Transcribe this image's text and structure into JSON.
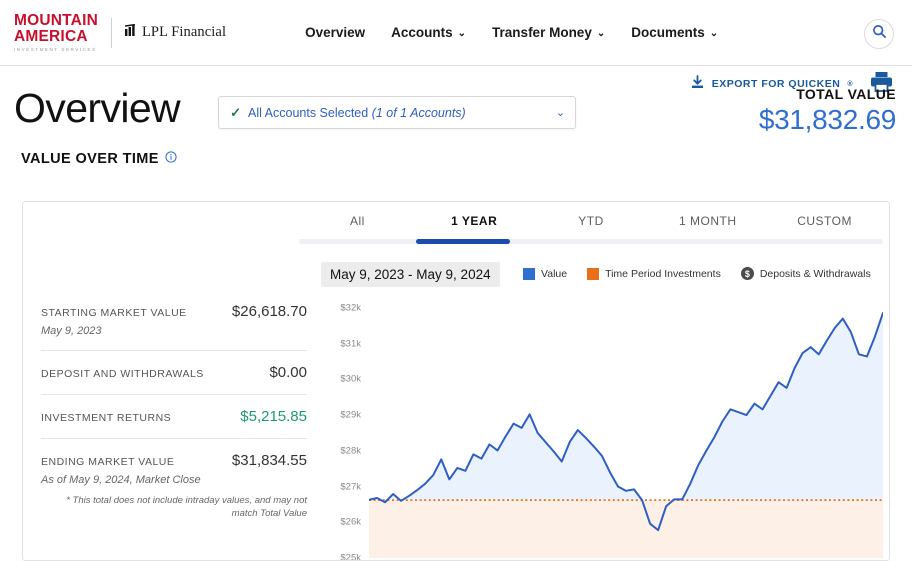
{
  "header": {
    "brand": {
      "mountain_line1": "MOUNTAIN",
      "mountain_line2": "AMERICA",
      "tagline": "INVESTMENT SERVICES",
      "partner": "LPL Financial"
    },
    "nav": [
      {
        "label": "Overview",
        "has_caret": false
      },
      {
        "label": "Accounts",
        "has_caret": true
      },
      {
        "label": "Transfer Money",
        "has_caret": true
      },
      {
        "label": "Documents",
        "has_caret": true
      }
    ],
    "search_icon": "search-icon"
  },
  "actions": {
    "export_label": "EXPORT FOR QUICKEN",
    "export_sup": "®",
    "download_icon": "download-icon",
    "print_icon": "printer-icon"
  },
  "page": {
    "title": "Overview",
    "account_selector": {
      "check": "✓",
      "text": "All Accounts Selected",
      "count": "(1 of 1 Accounts)",
      "caret": "⌄"
    },
    "total_label": "TOTAL VALUE",
    "total_value": "$31,832.69"
  },
  "section": {
    "title": "VALUE OVER TIME",
    "info_icon": "info-icon"
  },
  "tabs": [
    {
      "label": "All",
      "active": false
    },
    {
      "label": "1 YEAR",
      "active": true
    },
    {
      "label": "YTD",
      "active": false
    },
    {
      "label": "1 MONTH",
      "active": false
    },
    {
      "label": "CUSTOM",
      "active": false
    }
  ],
  "chart_header": {
    "date_range": "May 9, 2023 - May 9, 2024",
    "legend": [
      {
        "label": "Value",
        "type": "square",
        "color": "#2f6fd0"
      },
      {
        "label": "Time Period Investments",
        "type": "square",
        "color": "#e8701a"
      },
      {
        "label": "Deposits & Withdrawals",
        "type": "coin",
        "color": "#4b4b4b",
        "glyph": "$"
      }
    ]
  },
  "stats": [
    {
      "label": "STARTING MARKET VALUE",
      "value": "$26,618.70",
      "sub": "May 9, 2023",
      "value_color": "#333333"
    },
    {
      "label": "DEPOSIT AND WITHDRAWALS",
      "value": "$0.00",
      "sub": "",
      "value_color": "#333333"
    },
    {
      "label": "INVESTMENT RETURNS",
      "value": "$5,215.85",
      "sub": "",
      "value_color": "#1e9a6e"
    },
    {
      "label": "ENDING MARKET VALUE",
      "value": "$31,834.55",
      "sub": "As of May 9, 2024, Market Close",
      "value_color": "#333333"
    }
  ],
  "footnote": "* This total does not include intraday values, and may not match Total Value",
  "chart_data": {
    "type": "area",
    "title": "VALUE OVER TIME",
    "xlabel": "",
    "ylabel": "",
    "ylim": [
      25000,
      32500
    ],
    "yticks": [
      32000,
      31000,
      30000,
      29000,
      28000,
      27000,
      26000,
      25000
    ],
    "ytick_labels": [
      "$32k",
      "$31k",
      "$30k",
      "$29k",
      "$28k",
      "$27k",
      "$26k",
      "$25k"
    ],
    "grid": false,
    "legend_position": "top-right",
    "baseline_value": 26618.7,
    "baseline_color": "#e8701a",
    "line_color": "#2f5fc4",
    "fill_above_color": "#eaf3fd",
    "fill_below_color": "#fdf1e7",
    "x_start": "May 9, 2023",
    "x_end": "May 9, 2024",
    "series": [
      {
        "name": "Value",
        "values": [
          26630,
          26680,
          26560,
          26790,
          26600,
          26740,
          26900,
          27080,
          27320,
          27760,
          27200,
          27520,
          27440,
          27900,
          27780,
          28180,
          28010,
          28400,
          28760,
          28640,
          29020,
          28500,
          28240,
          27980,
          27700,
          28250,
          28580,
          28360,
          28120,
          27860,
          27400,
          27000,
          26880,
          26920,
          26620,
          25960,
          25780,
          26450,
          26640,
          26640,
          27080,
          27600,
          28000,
          28380,
          28820,
          29160,
          29080,
          29000,
          29320,
          29160,
          29540,
          29920,
          29760,
          30320,
          30740,
          30900,
          30700,
          31080,
          31440,
          31700,
          31320,
          30700,
          30640,
          31200,
          31860
        ]
      }
    ]
  }
}
